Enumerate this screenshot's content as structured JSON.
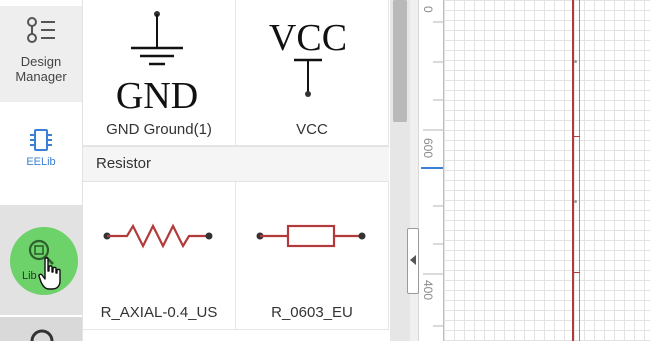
{
  "sidebar": {
    "design_manager_label": "Design\nManager",
    "eelib_label": "EELib",
    "lib_label": "Lib"
  },
  "library": {
    "gnd_symbol_text": "GND",
    "vcc_symbol_text": "VCC",
    "items": [
      {
        "name": "GND Ground(1)"
      },
      {
        "name": "VCC"
      },
      {
        "name": "R_AXIAL-0.4_US"
      },
      {
        "name": "R_0603_EU"
      }
    ],
    "section_title": "Resistor"
  },
  "ruler": {
    "labels": [
      "0",
      "600",
      "400"
    ]
  },
  "colors": {
    "accent_blue": "#3c7fd6",
    "lib_green": "#6dd26a",
    "resistor_red": "#b23a3a",
    "canvas_line": "#b23a3a"
  },
  "icons": {
    "design_manager": "list-tree-icon",
    "eelib": "chip-icon",
    "lib": "search-chip-icon",
    "cursor": "hand-pointer-icon",
    "collapse": "caret-left-icon"
  }
}
